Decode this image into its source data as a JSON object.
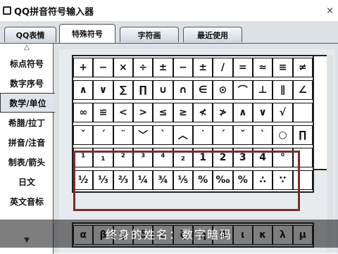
{
  "window": {
    "title": "QQ拼音符号输入器",
    "close": "×"
  },
  "tabs": [
    {
      "label": "QQ表情"
    },
    {
      "label": "特殊符号"
    },
    {
      "label": "字符画"
    },
    {
      "label": "最近使用"
    }
  ],
  "sidebar": {
    "up": "△",
    "items": [
      {
        "label": "标点符号"
      },
      {
        "label": "数字序号"
      },
      {
        "label": "数学/单位"
      },
      {
        "label": "希腊/拉丁"
      },
      {
        "label": "拼音/注音"
      },
      {
        "label": "制表/箭头"
      },
      {
        "label": "日文"
      },
      {
        "label": "英文音标"
      }
    ],
    "down": "▼"
  },
  "symbols_top": [
    [
      "+",
      "−",
      "×",
      "÷",
      "±",
      "−",
      "±",
      "/",
      "=",
      "≈",
      "≡",
      "≠"
    ],
    [
      "∧",
      "∨",
      "∑",
      "∏",
      "∪",
      "∩",
      "∈",
      "⊙",
      "⌒",
      "⊥",
      "∥",
      "∠"
    ],
    [
      "∞",
      "≌",
      "<",
      ">",
      "≤",
      "≥",
      "≮",
      "≯",
      "∧",
      "∨",
      "√",
      ""
    ],
    [
      "ˇ",
      "ˊ",
      "¨",
      "﹀",
      "ˋ",
      "︿",
      "˙",
      "ˊ",
      "ˇ",
      "ˋ",
      "○",
      "∏"
    ],
    [
      "¹",
      "₁",
      "²",
      "³",
      "⁴",
      "₂",
      "1",
      "2",
      "3",
      "4",
      "°",
      ""
    ],
    [
      "½",
      "⅓",
      "⅔",
      "¼",
      "¾",
      "⅕",
      "%",
      "‰",
      "%",
      "∴",
      "∵",
      ""
    ]
  ],
  "symbols_bottom": [
    "α",
    "β",
    "γ",
    "δ",
    "ε",
    "ζ",
    "η",
    "θ",
    "ι",
    "κ",
    "λ",
    "μ"
  ],
  "subtitle": "终身的姓名：数字暗码"
}
